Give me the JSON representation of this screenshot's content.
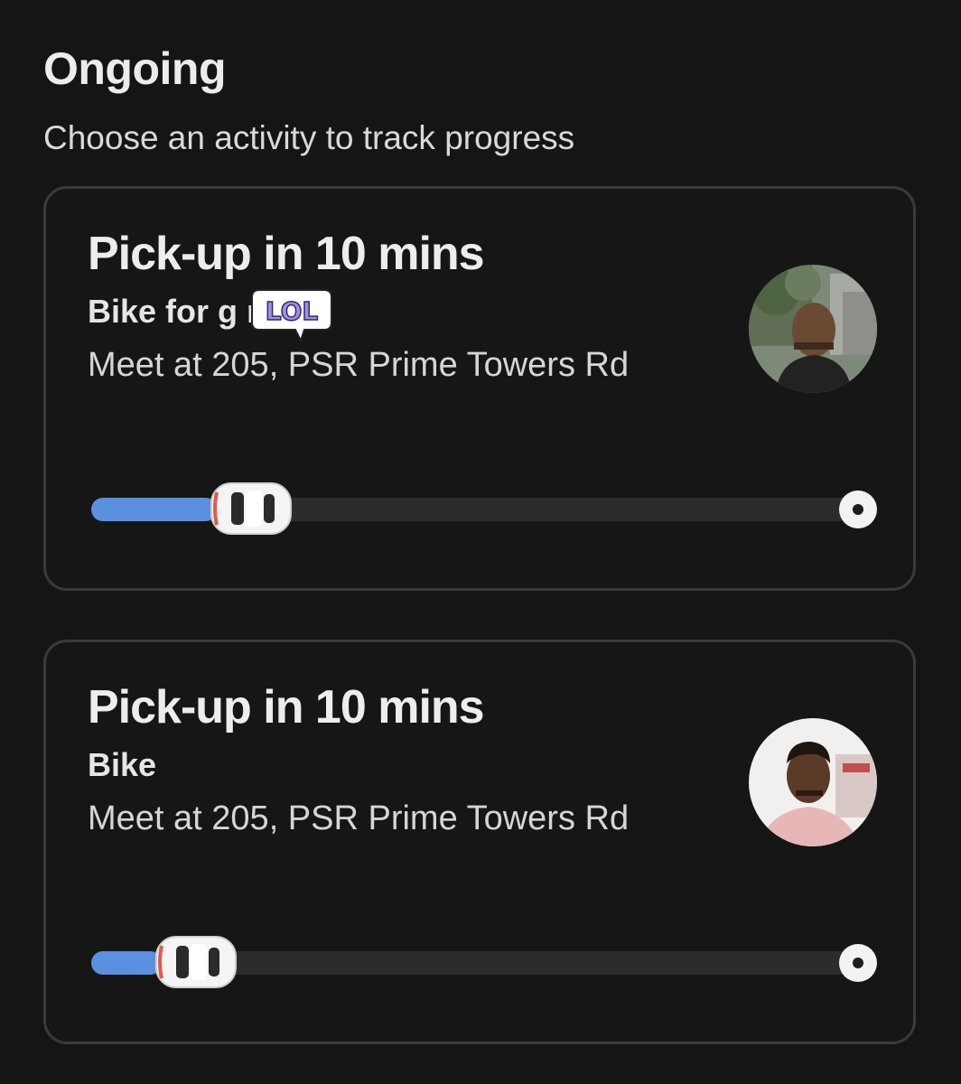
{
  "header": {
    "title": "Ongoing",
    "subtitle": "Choose an activity to track progress"
  },
  "activities": [
    {
      "title": "Pick-up in 10 mins",
      "vehicle": "Bike for g      nc",
      "meet": "Meet at 205, PSR Prime Towers Rd",
      "sticker_text": "LOL",
      "progress": 0.16
    },
    {
      "title": "Pick-up in 10 mins",
      "vehicle": "Bike",
      "meet": "Meet at 205, PSR Prime Towers Rd",
      "progress": 0.09
    }
  ],
  "colors": {
    "background": "#151515",
    "progress_fill": "#5b8fe0",
    "track": "#2c2c2c",
    "card_border": "#3a3a3a"
  },
  "icons": {
    "vehicle": "car-icon",
    "destination": "destination-marker-icon"
  }
}
